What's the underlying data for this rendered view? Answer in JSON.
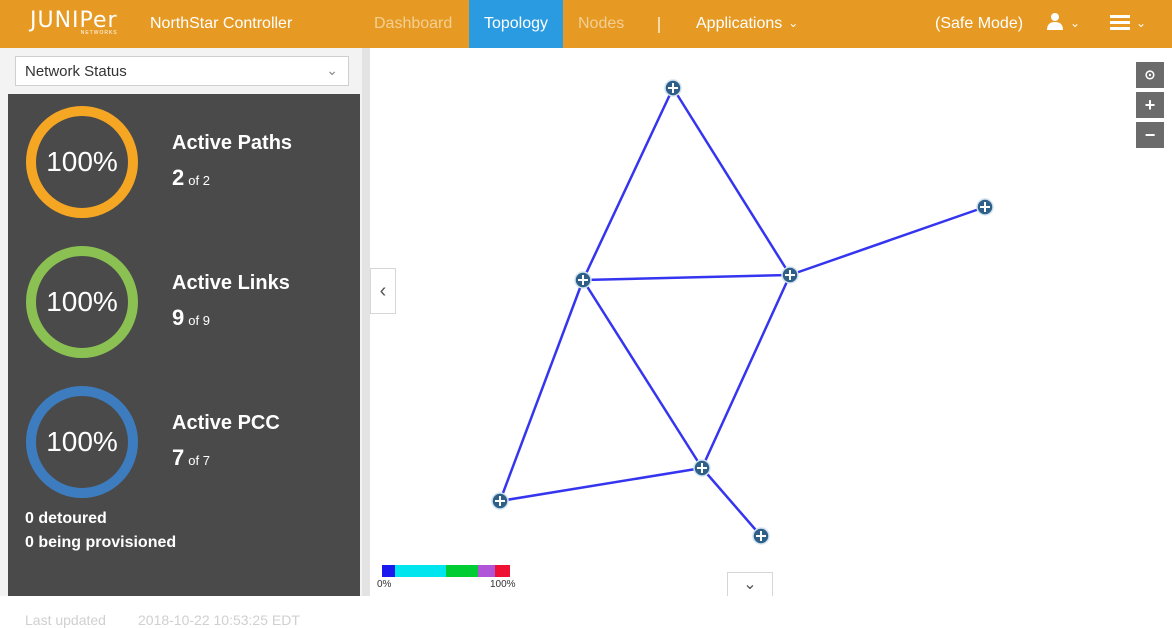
{
  "header": {
    "logo_text": "JUNIPer",
    "logo_sub": "NETWORKS",
    "app_name": "NorthStar Controller",
    "nav": {
      "dashboard": "Dashboard",
      "topology": "Topology",
      "nodes": "Nodes",
      "applications": "Applications"
    },
    "safe_mode": "(Safe Mode)",
    "user_icon": "user-icon",
    "menu_icon": "hamburger-icon",
    "colors": {
      "bar": "#e69a24",
      "active_tab": "#2a9be0"
    }
  },
  "sidebar": {
    "view_select": "Network Status",
    "metrics": [
      {
        "percent": "100%",
        "title": "Active Paths",
        "count": "2",
        "of": "of 2",
        "color": "#f5a623"
      },
      {
        "percent": "100%",
        "title": "Active Links",
        "count": "9",
        "of": "of 9",
        "color": "#8bc152"
      },
      {
        "percent": "100%",
        "title": "Active PCC",
        "count": "7",
        "of": "of 7",
        "color": "#3d7dbf"
      }
    ],
    "detoured": "0 detoured",
    "provisioning": "0 being provisioned",
    "last_updated_label": "Last updated",
    "last_updated_value": "2018-10-22 10:53:25 EDT"
  },
  "topology": {
    "link_color": "#3535f0",
    "legend": {
      "min": "0%",
      "max": "100%",
      "colors": [
        "#1a1aee",
        "#00e5ee",
        "#00cc33",
        "#b055d8",
        "#ee1133"
      ]
    },
    "zoom_controls": [
      "⊙",
      "+",
      "−"
    ]
  }
}
